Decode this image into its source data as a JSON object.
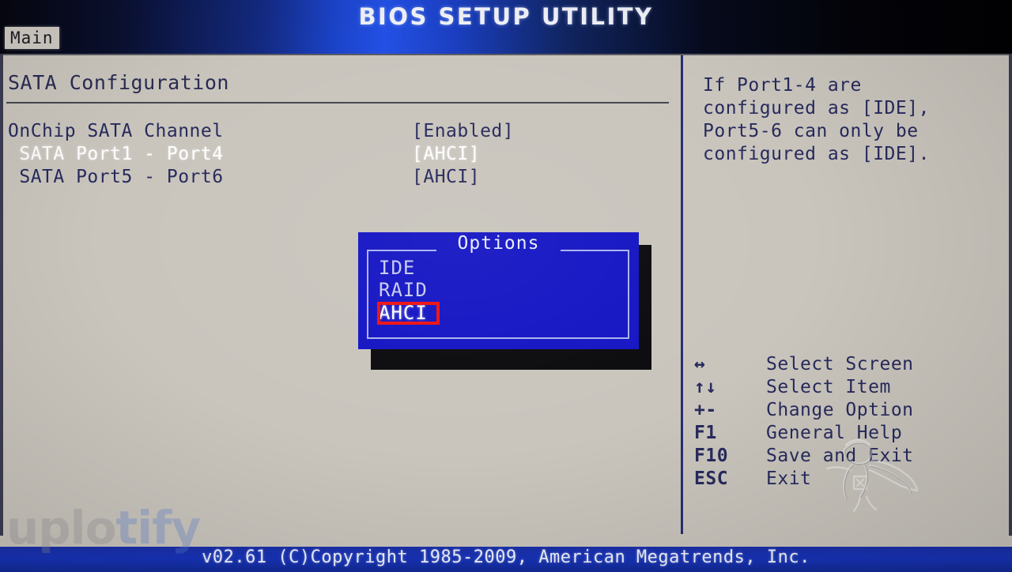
{
  "header": {
    "title": "BIOS SETUP UTILITY",
    "tabs": [
      {
        "label": "Main",
        "active": true
      }
    ]
  },
  "main": {
    "section_title": "SATA Configuration",
    "rows": [
      {
        "label": "OnChip SATA Channel",
        "value": "[Enabled]",
        "selected": false
      },
      {
        "label": " SATA Port1 - Port4",
        "value": "[AHCI]",
        "selected": true
      },
      {
        "label": " SATA Port5 - Port6",
        "value": "[AHCI]",
        "selected": false
      }
    ]
  },
  "dialog": {
    "title": "Options",
    "options": [
      {
        "label": "IDE",
        "selected": false
      },
      {
        "label": "RAID",
        "selected": false
      },
      {
        "label": "AHCI",
        "selected": true
      }
    ],
    "annotation_color": "#ee1111",
    "annotated_option": "AHCI"
  },
  "help": {
    "lines": [
      "If Port1-4 are",
      "configured as [IDE],",
      "Port5-6 can only be",
      "configured as [IDE]."
    ]
  },
  "legend": [
    {
      "key": "↔",
      "desc": "Select Screen"
    },
    {
      "key": "↑↓",
      "desc": "Select Item"
    },
    {
      "key": "+-",
      "desc": "Change Option"
    },
    {
      "key": "F1",
      "desc": "General Help"
    },
    {
      "key": "F10",
      "desc": "Save and Exit"
    },
    {
      "key": "ESC",
      "desc": "Exit"
    }
  ],
  "footer": {
    "text": "v02.61 (C)Copyright 1985-2009, American Megatrends, Inc."
  },
  "watermark": {
    "part1": "uplo",
    "part2": "tify"
  },
  "colors": {
    "background": "#c9c5bd",
    "text": "#272a5c",
    "highlight_text": "#ffffff",
    "dialog_background": "#1515c4",
    "dialog_border": "#a9b3ee",
    "footer_blue": "#1733b9",
    "annotation_red": "#ee1111"
  }
}
